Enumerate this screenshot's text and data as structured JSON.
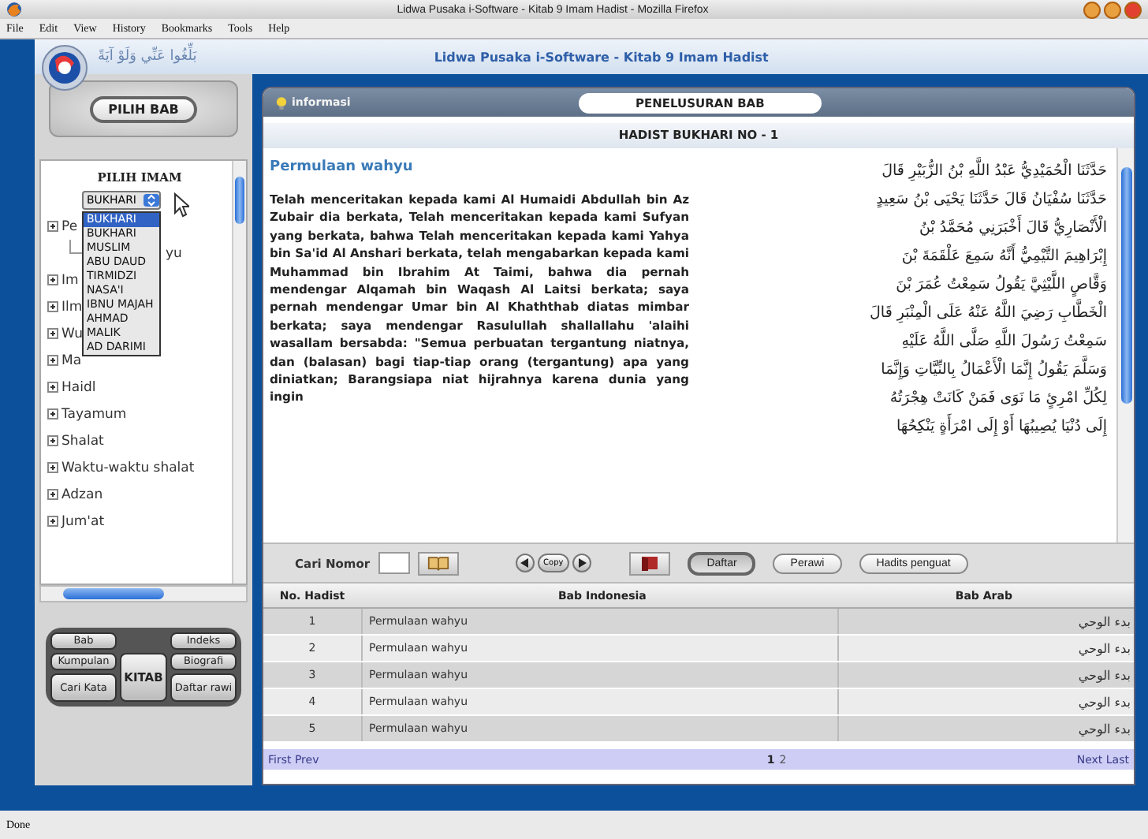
{
  "window": {
    "title": "Lidwa Pusaka i-Software - Kitab 9 Imam Hadist - Mozilla Firefox"
  },
  "menu": [
    "File",
    "Edit",
    "View",
    "History",
    "Bookmarks",
    "Tools",
    "Help"
  ],
  "app": {
    "motto": "بَلِّغُوا عَنِّي وَلَوْ آيَةً",
    "title": "Lidwa Pusaka i-Software - Kitab 9 Imam Hadist"
  },
  "sidebar": {
    "header_button": "PILIH BAB",
    "imam_label": "PILIH IMAM",
    "imam_select": "BUKHARI",
    "imam_options": [
      {
        "label": "BUKHARI",
        "selected": true
      },
      {
        "label": "BUKHARI",
        "selected": false
      },
      {
        "label": "MUSLIM",
        "selected": false
      },
      {
        "label": "ABU DAUD",
        "selected": false
      },
      {
        "label": "TIRMIDZI",
        "selected": false
      },
      {
        "label": "NASA'I",
        "selected": false
      },
      {
        "label": "IBNU MAJAH",
        "selected": false
      },
      {
        "label": "AHMAD",
        "selected": false
      },
      {
        "label": "MALIK",
        "selected": false
      },
      {
        "label": "AD DARIMI",
        "selected": false
      }
    ],
    "tree": [
      {
        "label": "Pe",
        "children": [
          {
            "label": "yu"
          }
        ]
      },
      {
        "label": "Im"
      },
      {
        "label": "Ilm"
      },
      {
        "label": "Wu"
      },
      {
        "label": "Ma"
      },
      {
        "label": "Haidl"
      },
      {
        "label": "Tayamum"
      },
      {
        "label": "Shalat"
      },
      {
        "label": "Waktu-waktu shalat"
      },
      {
        "label": "Adzan"
      },
      {
        "label": "Jum'at"
      }
    ],
    "buttons": {
      "top_left": "Bab",
      "top_right": "Indeks",
      "mid_left": "Kumpulan",
      "center": "KITAB",
      "mid_right": "Biografi",
      "bottom_left": "Cari Kata",
      "bottom_right": "Daftar rawi"
    }
  },
  "main": {
    "info_label": "informasi",
    "section_title": "PENELUSURAN BAB",
    "hadith_heading": "HADIST BUKHARI NO - 1",
    "chapter_title": "Permulaan wahyu",
    "translation": "Telah menceritakan kepada kami Al Humaidi Abdullah bin Az Zubair dia berkata, Telah menceritakan kepada kami Sufyan yang berkata, bahwa Telah menceritakan kepada kami Yahya bin Sa'id Al Anshari berkata, telah mengabarkan kepada kami Muhammad bin Ibrahim At Taimi, bahwa dia pernah mendengar Alqamah bin Waqash Al Laitsi berkata; saya pernah mendengar Umar bin Al Khaththab diatas mimbar berkata; saya mendengar Rasulullah shallallahu 'alaihi wasallam bersabda: \"Semua perbuatan tergantung niatnya, dan (balasan) bagi tiap-tiap orang (tergantung) apa yang diniatkan; Barangsiapa niat hijrahnya karena dunia yang ingin",
    "arabic_lines": [
      "حَدَّثَنَا الْحُمَيْدِيُّ عَبْدُ اللَّهِ بْنُ الزُّبَيْرِ قَالَ",
      "حَدَّثَنَا سُفْيَانُ قَالَ حَدَّثَنَا يَحْيَى بْنُ سَعِيدٍ",
      "الْأَنْصَارِيُّ قَالَ أَخْبَرَنِي مُحَمَّدُ بْنُ",
      "إِبْرَاهِيمَ التَّيْمِيُّ أَنَّهُ سَمِعَ عَلْقَمَةَ بْنَ",
      "وَقَّاصٍ اللَّيْثِيَّ يَقُولُ سَمِعْتُ عُمَرَ بْنَ",
      "الْخَطَّابِ رَضِيَ اللَّهُ عَنْهُ عَلَى الْمِنْبَرِ قَالَ",
      "سَمِعْتُ رَسُولَ اللَّهِ صَلَّى اللَّهُ عَلَيْهِ",
      "وَسَلَّمَ يَقُولُ إِنَّمَا الْأَعْمَالُ بِالنِّيَّاتِ وَإِنَّمَا",
      "لِكُلِّ امْرِئٍ مَا نَوَى فَمَنْ كَانَتْ هِجْرَتُهُ",
      "إِلَى دُنْيَا يُصِيبُهَا أَوْ إِلَى امْرَأَةٍ يَنْكِحُهَا"
    ],
    "search_label": "Cari Nomor",
    "copy_button": "Copy",
    "tabs": [
      {
        "label": "Daftar",
        "selected": true
      },
      {
        "label": "Perawi",
        "selected": false
      },
      {
        "label": "Hadits penguat",
        "selected": false
      }
    ],
    "table": {
      "columns": [
        "No. Hadist",
        "Bab Indonesia",
        "Bab Arab"
      ],
      "rows": [
        [
          "1",
          "Permulaan wahyu",
          "بدء الوحي"
        ],
        [
          "2",
          "Permulaan wahyu",
          "بدء الوحي"
        ],
        [
          "3",
          "Permulaan wahyu",
          "بدء الوحي"
        ],
        [
          "4",
          "Permulaan wahyu",
          "بدء الوحي"
        ],
        [
          "5",
          "Permulaan wahyu",
          "بدء الوحي"
        ]
      ]
    },
    "pager": {
      "first_prev": "First Prev",
      "pages": [
        {
          "label": "1",
          "selected": true
        },
        {
          "label": "2",
          "selected": false
        }
      ],
      "next_last": "Next Last"
    }
  },
  "status_bar": "Done"
}
